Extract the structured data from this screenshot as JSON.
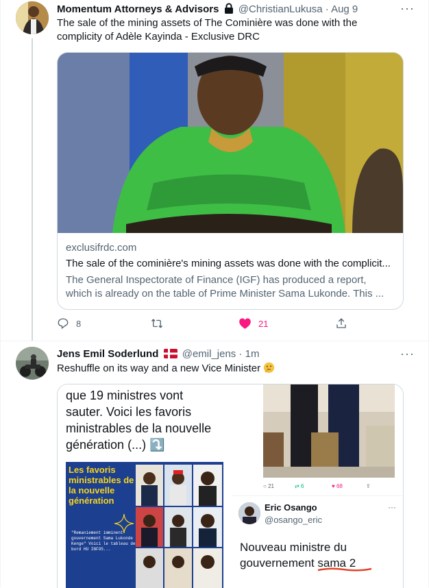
{
  "tweet1": {
    "author": "Momentum Attorneys & Advisors",
    "handle": "@ChristianLukusa",
    "dot": "·",
    "time": "Aug 9",
    "text": "The sale of the mining assets of The Cominière was done with the complicity of Adèle Kayinda - Exclusive DRC",
    "card": {
      "domain": "exclusifrdc.com",
      "title": "The sale of the cominière's mining assets was done with the complicit...",
      "description": "The General Inspectorate of Finance (IGF) has produced a report, which is already on the table of Prime Minister Sama Lukonde. This ..."
    },
    "stats": {
      "replies": "8",
      "retweets": "",
      "likes": "21"
    },
    "more": "···"
  },
  "tweet2": {
    "author": "Jens Emil Soderlund",
    "flag": "🇩🇰",
    "handle": "@emil_jens",
    "dot": "·",
    "time": "1m",
    "text": "Reshuffle on its way and a new Vice Minister",
    "emoji": "🤔",
    "more": "···",
    "media_left": {
      "text": "que 19 ministres vont sauter. Voici les favoris ministrables de la nouvelle génération (...) ⤵️",
      "poster_title": "Les favoris ministrables de la nouvelle génération",
      "poster_caption": "\"Remaniement imminent gouvernement Sama Lukonde Kenge\" Voici le tableau de bord HU INFOS..."
    },
    "media_right": {
      "stats": {
        "replies": "21",
        "retweets": "6",
        "likes": "68"
      },
      "quoted_name": "Eric Osango",
      "quoted_handle": "@osango_eric",
      "quoted_text": "Nouveau ministre du gouvernement sama 2"
    }
  },
  "colors": {
    "like": "#f91880",
    "muted": "#536471",
    "border": "#cfd9de",
    "text": "#0f1419"
  }
}
